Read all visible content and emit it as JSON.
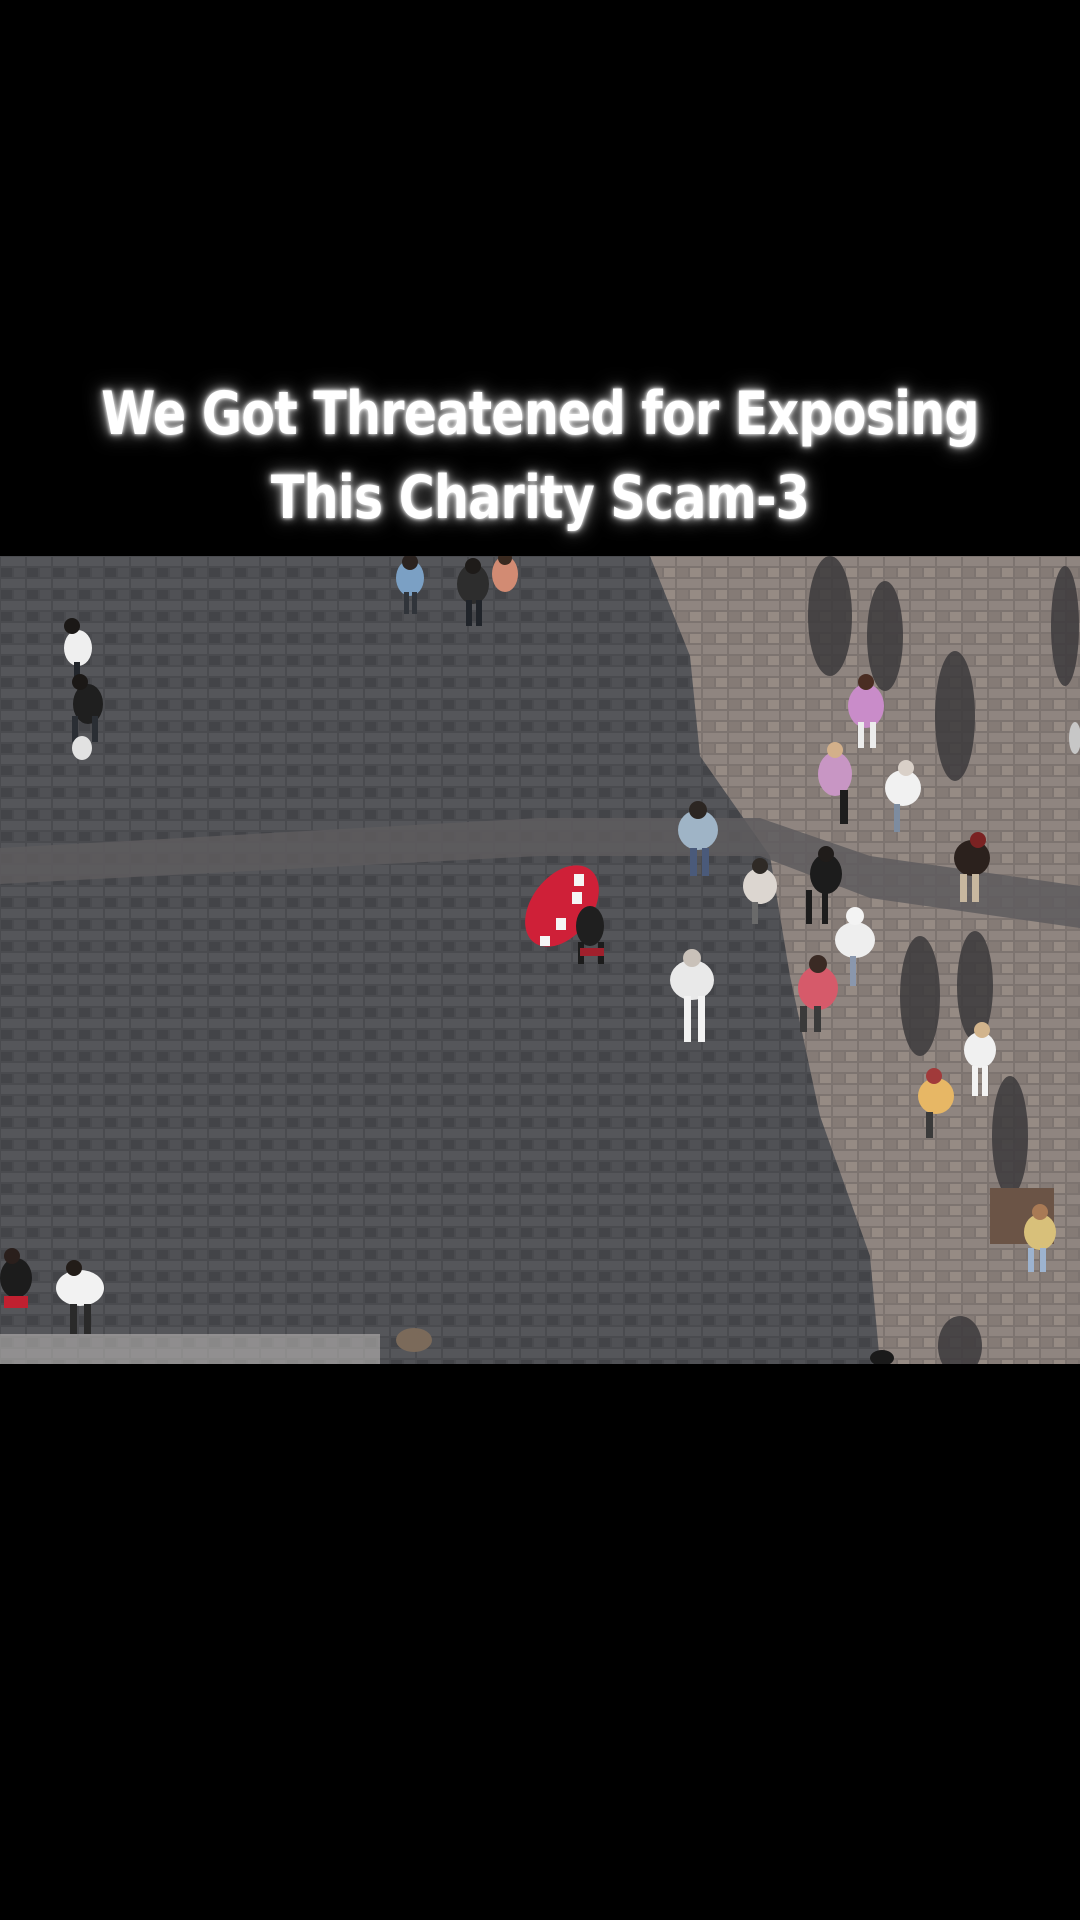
{
  "video": {
    "caption_line1": "We Got Threatened for Exposing",
    "caption_line2": "This Charity Scam-3"
  },
  "colors": {
    "background": "#000000",
    "caption_text": "#ffffff",
    "pavement_shadow": "#4a4b4f",
    "pavement_sunlit": "#8a7e76",
    "umbrella": "#d0213a"
  }
}
